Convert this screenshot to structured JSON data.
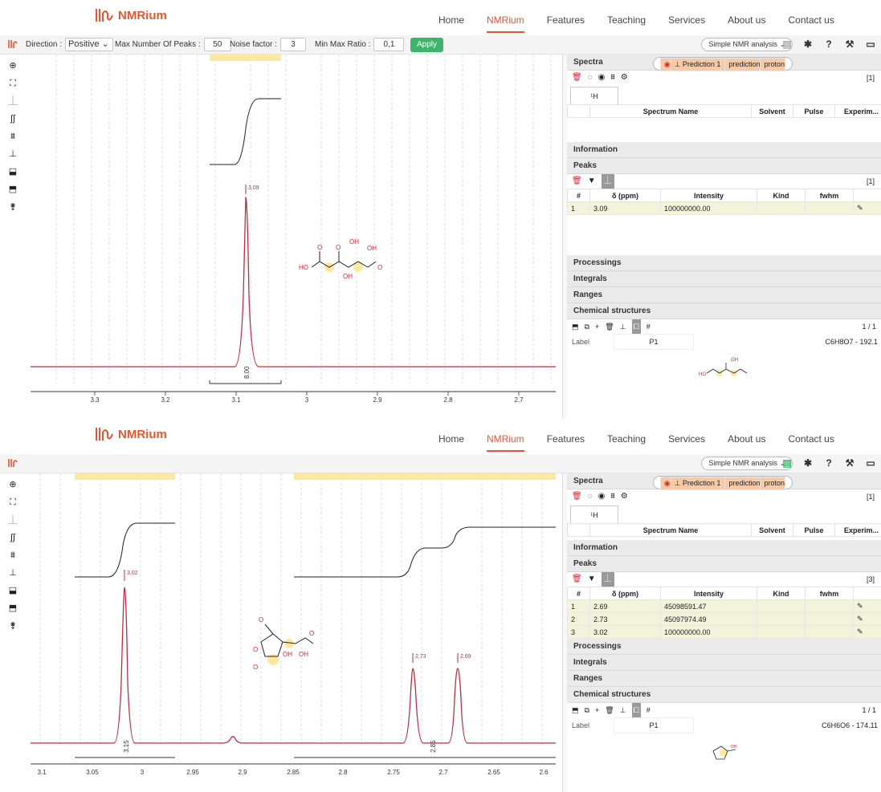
{
  "nav": {
    "brand": "NMRium",
    "links": [
      "Home",
      "NMRium",
      "Features",
      "Teaching",
      "Services",
      "About us",
      "Contact us"
    ],
    "active": "NMRium"
  },
  "peak_toolbar": {
    "direction_label": "Direction :",
    "direction_value": "Positive",
    "max_peaks_label": "Max Number Of Peaks :",
    "max_peaks_value": "50",
    "noise_label": "Noise factor :",
    "noise_value": "3",
    "minmax_label": "Min Max Ratio :",
    "minmax_value": "0,1",
    "apply": "Apply"
  },
  "analysis_select": "Simple NMR analysis",
  "panels": [
    {
      "spectra": {
        "title": "Spectra",
        "count": "[1]",
        "tab": "¹H",
        "headers": [
          "Spectrum Name",
          "Solvent",
          "Pulse",
          "Experim..."
        ],
        "rows": [
          {
            "name": "Prediction 1",
            "solvent": "",
            "pulse": "prediction",
            "experiment": "proton"
          }
        ]
      },
      "info_title": "Information",
      "peaks": {
        "title": "Peaks",
        "count": "[1]",
        "headers": [
          "#",
          "δ (ppm)",
          "Intensity",
          "Kind",
          "fwhm"
        ],
        "rows": [
          [
            "1",
            "3.09",
            "100000000.00",
            "",
            ""
          ]
        ]
      },
      "processings": "Processings",
      "integrals": "Integrals",
      "ranges": "Ranges",
      "chem": {
        "title": "Chemical structures",
        "page": "1 / 1",
        "label_caption": "Label",
        "label": "P1",
        "formula": "C6H8O7 - 192.1"
      },
      "spectrum": {
        "ticks": [
          "3.3",
          "3.2",
          "3.1",
          "3",
          "2.9",
          "2.8",
          "2.7"
        ],
        "peak_labels": [
          "3,09"
        ],
        "integral_value": "8.00",
        "molecule_labels": [
          "HO",
          "O",
          "OH",
          "O",
          "OH",
          "O",
          "OH"
        ]
      }
    },
    {
      "spectra": {
        "title": "Spectra",
        "count": "[1]",
        "tab": "¹H",
        "headers": [
          "Spectrum Name",
          "Solvent",
          "Pulse",
          "Experim..."
        ],
        "rows": [
          {
            "name": "Prediction 1",
            "solvent": "",
            "pulse": "prediction",
            "experiment": "proton"
          }
        ]
      },
      "info_title": "Information",
      "peaks": {
        "title": "Peaks",
        "count": "[3]",
        "headers": [
          "#",
          "δ (ppm)",
          "Intensity",
          "Kind",
          "fwhm"
        ],
        "rows": [
          [
            "1",
            "2.69",
            "45098591.47",
            "",
            ""
          ],
          [
            "2",
            "2.73",
            "45097974.49",
            "",
            ""
          ],
          [
            "3",
            "3.02",
            "100000000.00",
            "",
            ""
          ]
        ]
      },
      "processings": "Processings",
      "integrals": "Integrals",
      "ranges": "Ranges",
      "chem": {
        "title": "Chemical structures",
        "page": "1 / 1",
        "label_caption": "Label",
        "label": "P1",
        "formula": "C6H6O6 - 174.11"
      },
      "spectrum": {
        "ticks": [
          "3.1",
          "3.05",
          "3",
          "2.95",
          "2.9",
          "2.85",
          "2.8",
          "2.75",
          "2.7",
          "2.65",
          "2.6"
        ],
        "peak_labels": [
          "3,02",
          "2,73",
          "2,69"
        ],
        "integral_values": [
          "3.15",
          "2.85"
        ],
        "molecule_labels": [
          "O",
          "O",
          "O",
          "OH",
          "OH",
          "O"
        ]
      }
    }
  ],
  "colors": {
    "accent": "#e8542d",
    "spectrum": "#c02c3c",
    "selected_row": "#f8c9a4",
    "peak_row": "#f3f3dc",
    "apply": "#3db36b"
  }
}
